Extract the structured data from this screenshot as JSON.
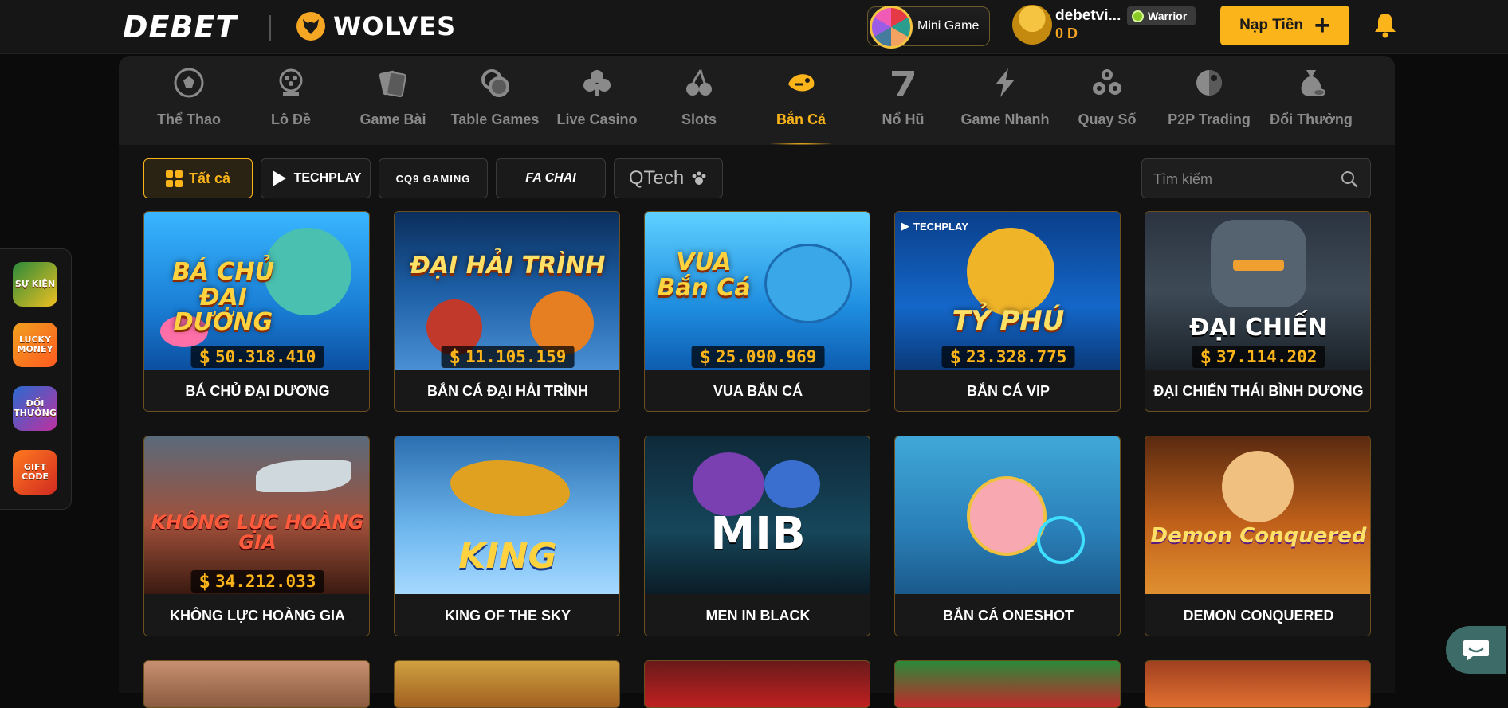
{
  "header": {
    "logo": "DEBET",
    "partner": "WOLVES",
    "minigame_label": "Mini Game",
    "user": {
      "name": "debetvi...",
      "balance": "0 D",
      "rank": "Warrior"
    },
    "deposit_label": "Nạp Tiền"
  },
  "nav": {
    "items": [
      {
        "label": "Thể Thao",
        "icon": "soccer-ball-icon"
      },
      {
        "label": "Lô Đề",
        "icon": "lottery-icon"
      },
      {
        "label": "Game Bài",
        "icon": "cards-icon"
      },
      {
        "label": "Table Games",
        "icon": "chips-icon"
      },
      {
        "label": "Live Casino",
        "icon": "clubs-icon"
      },
      {
        "label": "Slots",
        "icon": "cherry-icon"
      },
      {
        "label": "Bắn Cá",
        "icon": "fish-icon",
        "active": true
      },
      {
        "label": "Nổ Hũ",
        "icon": "seven-icon"
      },
      {
        "label": "Game Nhanh",
        "icon": "lightning-icon"
      },
      {
        "label": "Quay Số",
        "icon": "balls-icon"
      },
      {
        "label": "P2P Trading",
        "icon": "p2p-icon"
      },
      {
        "label": "Đổi Thưởng",
        "icon": "moneybag-icon"
      }
    ]
  },
  "filters": {
    "all_label": "Tất cả",
    "providers": [
      "TECHPLAY",
      "CQ9 GAMING",
      "FA CHAI",
      "QTech"
    ]
  },
  "search": {
    "placeholder": "Tìm kiếm"
  },
  "games": [
    {
      "name": "BÁ CHỦ ĐẠI DƯƠNG",
      "art_title": "BÁ CHỦ ĐẠI DƯƠNG",
      "jackpot": "50.318.410"
    },
    {
      "name": "BẮN CÁ ĐẠI HẢI TRÌNH",
      "art_title": "ĐẠI HẢI TRÌNH",
      "jackpot": "11.105.159"
    },
    {
      "name": "VUA BẮN CÁ",
      "art_title": "VUA Bắn Cá",
      "jackpot": "25.090.969"
    },
    {
      "name": "BẮN CÁ VIP",
      "art_title": "TỶ PHÚ",
      "jackpot": "23.328.775"
    },
    {
      "name": "ĐẠI CHIẾN THÁI BÌNH DƯƠNG",
      "art_title": "ĐẠI CHIẾN",
      "jackpot": "37.114.202"
    },
    {
      "name": "KHÔNG LỰC HOÀNG GIA",
      "art_title": "KHÔNG LỰC HOÀNG GIA",
      "jackpot": "34.212.033"
    },
    {
      "name": "KING OF THE SKY",
      "art_title": "KING",
      "jackpot": ""
    },
    {
      "name": "MEN IN BLACK",
      "art_title": "MIB",
      "jackpot": ""
    },
    {
      "name": "BẮN CÁ ONESHOT",
      "art_title": "",
      "jackpot": ""
    },
    {
      "name": "DEMON CONQUERED",
      "art_title": "Demon Conquered",
      "jackpot": ""
    }
  ],
  "side_promos": [
    "SỰ KIỆN",
    "LUCKY MONEY",
    "ĐỔI THƯỞNG",
    "GIFT CODE"
  ],
  "colors": {
    "accent": "#fbb41a",
    "background": "#0b0b0b",
    "panel": "#1d1d1d"
  }
}
